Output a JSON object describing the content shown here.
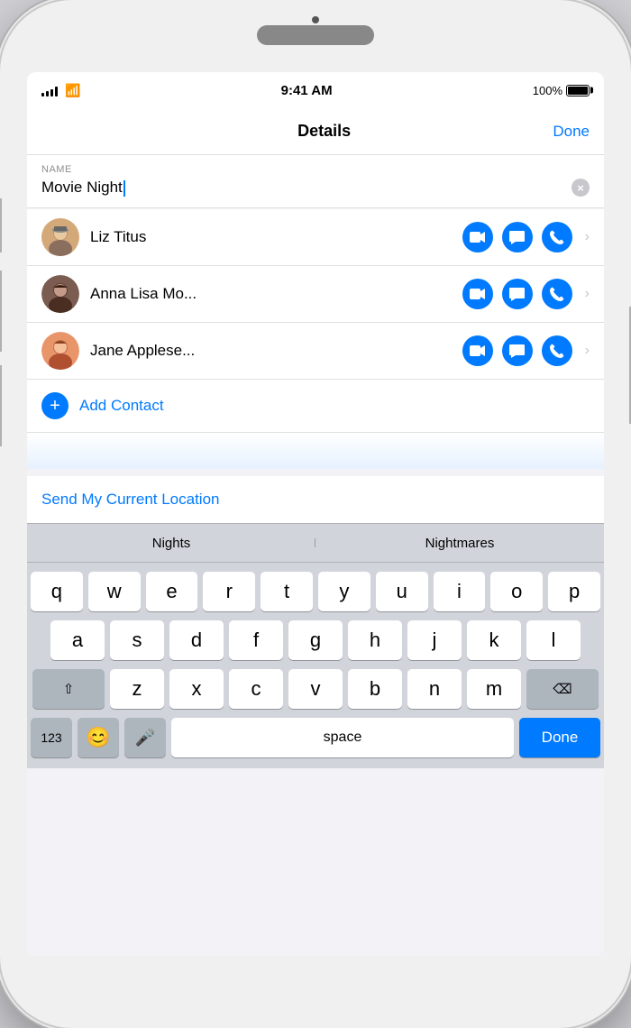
{
  "phone": {
    "status_bar": {
      "time": "9:41 AM",
      "battery_percent": "100%"
    },
    "nav": {
      "title": "Details",
      "done_label": "Done"
    },
    "name_section": {
      "label": "NAME",
      "value": "Movie Night",
      "clear_button_label": "×"
    },
    "contacts": [
      {
        "id": "liz-titus",
        "name": "Liz Titus",
        "avatar_style": "liz"
      },
      {
        "id": "anna-lisa",
        "name": "Anna Lisa Mo...",
        "avatar_style": "anna"
      },
      {
        "id": "jane-apple",
        "name": "Jane Applese...",
        "avatar_style": "jane"
      }
    ],
    "add_contact_label": "Add Contact",
    "location_label": "Send My Current Location",
    "autocomplete": {
      "items": [
        "Nights",
        "Nightmares"
      ]
    },
    "keyboard": {
      "rows": [
        [
          "q",
          "w",
          "e",
          "r",
          "t",
          "y",
          "u",
          "i",
          "o",
          "p"
        ],
        [
          "a",
          "s",
          "d",
          "f",
          "g",
          "h",
          "j",
          "k",
          "l"
        ],
        [
          "z",
          "x",
          "c",
          "v",
          "b",
          "n",
          "m"
        ]
      ],
      "bottom": {
        "key_123": "123",
        "emoji": "😊",
        "mic": "🎤",
        "space": "space",
        "done": "Done"
      }
    }
  }
}
